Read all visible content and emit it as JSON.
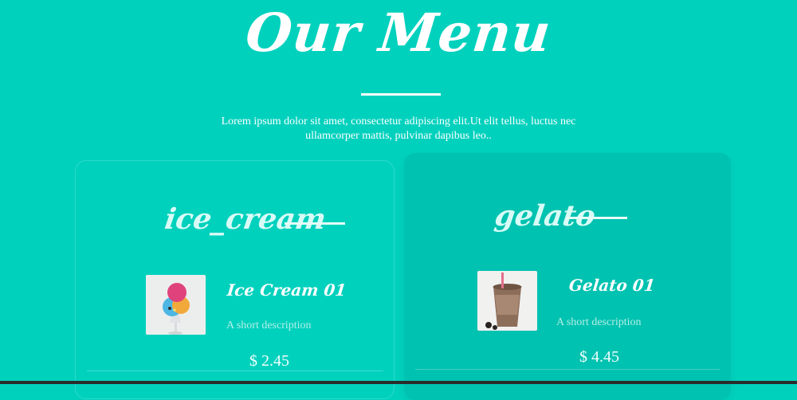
{
  "header": {
    "title": "Our Menu",
    "intro": "Lorem ipsum dolor sit amet, consectetur adipiscing elit.Ut elit tellus, luctus nec ullamcorper mattis, pulvinar dapibus leo.."
  },
  "menus": [
    {
      "category": "ice_cream",
      "item": {
        "name": "Ice Cream 01",
        "description": "A short description",
        "price": "$ 2.45",
        "image_icon": "ice-cream-icon"
      }
    },
    {
      "category": "gelato",
      "item": {
        "name": "Gelato 01",
        "description": "A short description",
        "price": "$ 4.45",
        "image_icon": "gelato-cup-icon"
      }
    }
  ],
  "colors": {
    "background": "#00d1bd",
    "card_highlight": "#00c2b0",
    "text": "#ffffff"
  }
}
